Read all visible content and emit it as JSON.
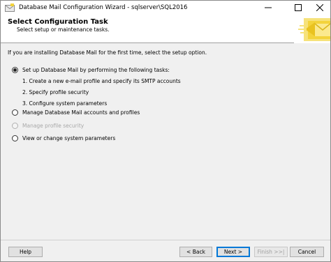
{
  "window": {
    "title": "Database Mail Configuration Wizard - sqlserver\\SQL2016",
    "controls": [
      "minimize-icon",
      "maximize-icon",
      "close-icon"
    ]
  },
  "header": {
    "title": "Select Configuration Task",
    "subtitle": "Select setup or maintenance tasks."
  },
  "content": {
    "intro": "If you are installing Database Mail for the first time, select the setup option.",
    "options": [
      {
        "label": "Set up Database Mail by performing the following tasks:",
        "checked": true,
        "enabled": true
      },
      {
        "label": "Manage Database Mail accounts and profiles",
        "checked": false,
        "enabled": true
      },
      {
        "label": "Manage profile security",
        "checked": false,
        "enabled": false
      },
      {
        "label": "View or change system parameters",
        "checked": false,
        "enabled": true
      }
    ],
    "steps": [
      "1. Create a new e-mail profile and specify its SMTP accounts",
      "2. Specify profile security",
      "3. Configure system parameters"
    ]
  },
  "footer": {
    "help": "Help",
    "back": "< Back",
    "next": "Next >",
    "finish": "Finish >>|",
    "cancel": "Cancel"
  },
  "colors": {
    "accent": "#0078d7",
    "header_graphic": "#f3d33b"
  }
}
